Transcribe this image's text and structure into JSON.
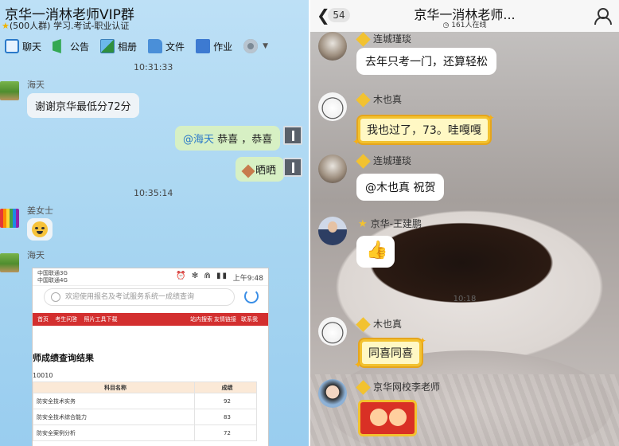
{
  "left": {
    "title": "京华一消林老师VIP群",
    "subtitle": "(500人群) 学习.考试-职业认证",
    "toolbar": [
      {
        "label": "聊天",
        "icon": "chat-icon"
      },
      {
        "label": "公告",
        "icon": "announcement-icon"
      },
      {
        "label": "相册",
        "icon": "album-icon"
      },
      {
        "label": "文件",
        "icon": "file-icon"
      },
      {
        "label": "作业",
        "icon": "homework-icon"
      }
    ],
    "timestamps": [
      "10:31:33",
      "10:35:14"
    ],
    "messages": {
      "m1_nick": "海天",
      "m1_text": "谢谢京华最低分72分",
      "m2_mention": "@海天",
      "m2_text": " 恭喜   ，恭喜",
      "m3_text": "晒晒",
      "m4_nick": "姜女士",
      "m5_nick": "海天"
    },
    "screenshot": {
      "carrier1": "中国联通3G",
      "carrier2": "中国联通4G",
      "status_icons": "⏰ ✻ ⋒ ▮▮",
      "time": "上午9:48",
      "search_placeholder": "欢迎使用报名及考试服务系统一成绩查询",
      "nav_left": [
        "首页",
        "考生问答",
        "照片工具下载"
      ],
      "nav_right": [
        "站内搜索",
        "友情链接",
        "联系我"
      ],
      "heading": "师成绩查询结果",
      "id_fragment": "10010",
      "table_head": [
        "科目名称",
        "成绩"
      ],
      "rows": [
        {
          "subject": "防安全技术实务",
          "score": "92"
        },
        {
          "subject": "防安全技术综合能力",
          "score": "83"
        },
        {
          "subject": "防安全案例分析",
          "score": "72"
        }
      ]
    }
  },
  "right": {
    "unread": "54",
    "title": "京华一消林老师...",
    "online": "161人在线",
    "timestamp": "10:18",
    "messages": [
      {
        "nick": "连城瑾琰",
        "text": "去年只考一门，还算轻松"
      },
      {
        "nick": "木也真",
        "text": "我也过了，73。哇嘎嘎"
      },
      {
        "nick": "连城瑾琰",
        "text": "@木也真 祝贺"
      },
      {
        "nick": "京华-王建鹏",
        "text": "👍"
      },
      {
        "nick": "木也真",
        "text": "同喜同喜"
      },
      {
        "nick": "京华网校李老师",
        "text": ""
      }
    ]
  },
  "colors": {
    "left_bg": "#a7d5f1",
    "my_bubble": "#d7f0c4",
    "mention": "#2a79c9",
    "vip_gold": "#f2c230",
    "red_nav": "#d32f2f"
  }
}
